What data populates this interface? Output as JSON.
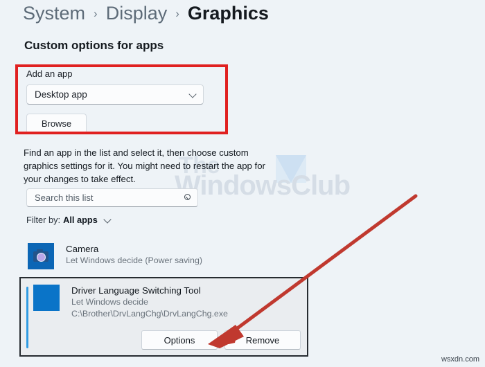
{
  "breadcrumb": {
    "items": [
      {
        "label": "System",
        "active": false
      },
      {
        "label": "Display",
        "active": false
      },
      {
        "label": "Graphics",
        "active": true
      }
    ],
    "separator": "›"
  },
  "section": {
    "heading": "Custom options for apps"
  },
  "add_app": {
    "label": "Add an app",
    "select_value": "Desktop app",
    "browse_label": "Browse",
    "highlight_color": "#e02020"
  },
  "description": {
    "text": "Find an app in the list and select it, then choose custom graphics settings for it. You might need to restart the app for your changes to take effect."
  },
  "search": {
    "placeholder": "Search this list",
    "value": "",
    "icon": "search-icon"
  },
  "filter": {
    "label": "Filter by:",
    "value": "All apps",
    "icon": "chevron-down-icon"
  },
  "app_list": [
    {
      "name": "Camera",
      "subtitle": "Let Windows decide (Power saving)",
      "path": "",
      "icon": "camera-icon",
      "selected": false
    }
  ],
  "selected_app": {
    "name": "Driver Language Switching Tool",
    "subtitle": "Let Windows decide",
    "path": "C:\\Brother\\DrvLangChg\\DrvLangChg.exe",
    "icon": "app-tile-icon",
    "accent_color": "#2f9be3",
    "actions": {
      "options_label": "Options",
      "remove_label": "Remove"
    }
  },
  "annotation": {
    "arrow_color": "#c0392f",
    "points_to": "Options"
  },
  "watermark": {
    "line1": "The",
    "line2": "WindowsClub"
  },
  "footer": {
    "credit": "wsxdn.com"
  }
}
